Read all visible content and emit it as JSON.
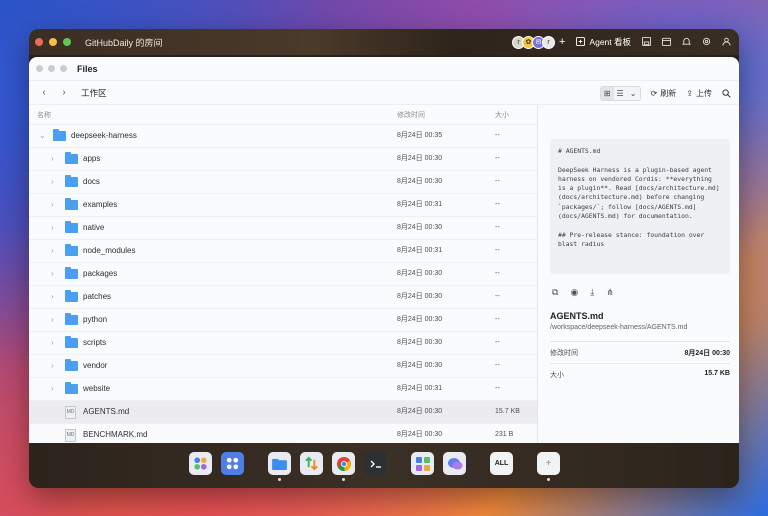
{
  "window": {
    "room_title": "GitHubDaily 的房间",
    "agent_label": "Agent 看板",
    "avatars": [
      "r",
      "✿",
      "✉",
      "r"
    ]
  },
  "files": {
    "title": "Files",
    "path": "工作区",
    "refresh_label": "刷新",
    "upload_label": "上传",
    "columns": {
      "name": "名称",
      "time": "修改时间",
      "size": "大小"
    },
    "rows": [
      {
        "name": "deepseek-harness",
        "time": "8月24日 00:35",
        "size": "--",
        "type": "folder",
        "level": 0,
        "expanded": true
      },
      {
        "name": "apps",
        "time": "8月24日 00:30",
        "size": "--",
        "type": "folder",
        "level": 1
      },
      {
        "name": "docs",
        "time": "8月24日 00:30",
        "size": "--",
        "type": "folder",
        "level": 1
      },
      {
        "name": "examples",
        "time": "8月24日 00:31",
        "size": "--",
        "type": "folder",
        "level": 1
      },
      {
        "name": "native",
        "time": "8月24日 00:30",
        "size": "--",
        "type": "folder",
        "level": 1
      },
      {
        "name": "node_modules",
        "time": "8月24日 00:31",
        "size": "--",
        "type": "folder",
        "level": 1
      },
      {
        "name": "packages",
        "time": "8月24日 00:30",
        "size": "--",
        "type": "folder",
        "level": 1
      },
      {
        "name": "patches",
        "time": "8月24日 00:30",
        "size": "--",
        "type": "folder",
        "level": 1
      },
      {
        "name": "python",
        "time": "8月24日 00:30",
        "size": "--",
        "type": "folder",
        "level": 1
      },
      {
        "name": "scripts",
        "time": "8月24日 00:30",
        "size": "--",
        "type": "folder",
        "level": 1
      },
      {
        "name": "vendor",
        "time": "8月24日 00:30",
        "size": "--",
        "type": "folder",
        "level": 1
      },
      {
        "name": "website",
        "time": "8月24日 00:31",
        "size": "--",
        "type": "folder",
        "level": 1
      },
      {
        "name": "AGENTS.md",
        "time": "8月24日 00:30",
        "size": "15.7 KB",
        "type": "md",
        "level": 1,
        "selected": true
      },
      {
        "name": "BENCHMARK.md",
        "time": "8月24日 00:30",
        "size": "231 B",
        "type": "md",
        "level": 1
      }
    ]
  },
  "preview": {
    "code": "# AGENTS.md\n\nDeepSeek Harness is a plugin-based agent harness on vendored Cordis: **everything is a plugin**. Read [docs/architecture.md](docs/architecture.md) before changing `packages/`; follow [docs/AGENTS.md](docs/AGENTS.md) for documentation.\n\n## Pre-release stance: foundation over blast radius",
    "file_name": "AGENTS.md",
    "file_path": "/workspace/deepseek-harness/AGENTS.md",
    "modified_label": "修改时间",
    "modified_value": "8月24日 00:30",
    "size_label": "大小",
    "size_value": "15.7 KB"
  },
  "dock": {
    "all_label": "ALL"
  }
}
